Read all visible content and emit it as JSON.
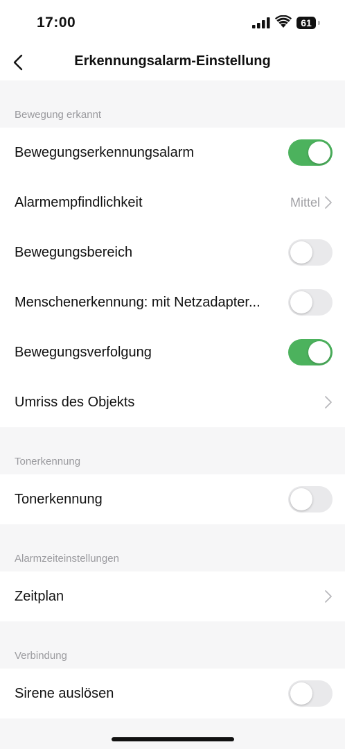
{
  "status_bar": {
    "time": "17:00",
    "battery_level": "61",
    "icons": [
      "cellular-signal-icon",
      "wifi-icon",
      "battery-icon"
    ]
  },
  "nav": {
    "title": "Erkennungsalarm-Einstellung",
    "back_icon": "chevron-left-icon"
  },
  "colors": {
    "toggle_on": "#4cb25d",
    "toggle_off": "#e9e9eb",
    "section_header_text": "#9a9a9e",
    "background": "#f6f6f7"
  },
  "sections": [
    {
      "header": "Bewegung erkannt",
      "rows": [
        {
          "label": "Bewegungserkennungsalarm",
          "type": "toggle",
          "on": true
        },
        {
          "label": "Alarmempfindlichkeit",
          "type": "link",
          "value": "Mittel"
        },
        {
          "label": "Bewegungsbereich",
          "type": "toggle",
          "on": false
        },
        {
          "label": "Menschenerkennung: mit Netzadapter...",
          "type": "toggle",
          "on": false
        },
        {
          "label": "Bewegungsverfolgung",
          "type": "toggle",
          "on": true
        },
        {
          "label": "Umriss des Objekts",
          "type": "link",
          "value": ""
        }
      ]
    },
    {
      "header": "Tonerkennung",
      "rows": [
        {
          "label": "Tonerkennung",
          "type": "toggle",
          "on": false
        }
      ]
    },
    {
      "header": "Alarmzeiteinstellungen",
      "rows": [
        {
          "label": "Zeitplan",
          "type": "link",
          "value": ""
        }
      ]
    },
    {
      "header": "Verbindung",
      "rows": [
        {
          "label": "Sirene auslösen",
          "type": "toggle",
          "on": false
        }
      ]
    }
  ]
}
